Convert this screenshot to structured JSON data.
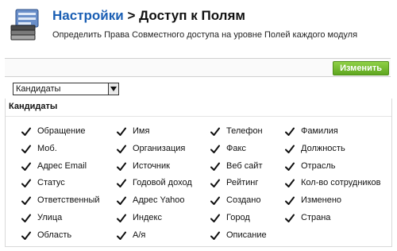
{
  "header": {
    "breadcrumb_link": "Настройки",
    "separator": ">",
    "page_title": "Доступ к Полям",
    "description": "Определить Права Совместного доступа на уровне Полей каждого модуля",
    "icon": "settings-list-icon"
  },
  "toolbar": {
    "edit_label": "Изменить",
    "edit_color": "#6bb52a"
  },
  "module_select": {
    "value": "Кандидаты"
  },
  "section": {
    "title": "Кандидаты",
    "fields": [
      {
        "label": "Обращение",
        "checked": true
      },
      {
        "label": "Имя",
        "checked": true
      },
      {
        "label": "Телефон",
        "checked": true
      },
      {
        "label": "Фамилия",
        "checked": true
      },
      {
        "label": "Моб.",
        "checked": true
      },
      {
        "label": "Организация",
        "checked": true
      },
      {
        "label": "Факс",
        "checked": true
      },
      {
        "label": "Должность",
        "checked": true
      },
      {
        "label": "Адрес Email",
        "checked": true
      },
      {
        "label": "Источник",
        "checked": true
      },
      {
        "label": "Веб сайт",
        "checked": true
      },
      {
        "label": "Отрасль",
        "checked": true
      },
      {
        "label": "Статус",
        "checked": true
      },
      {
        "label": "Годовой доход",
        "checked": true
      },
      {
        "label": "Рейтинг",
        "checked": true
      },
      {
        "label": "Кол-во сотрудников",
        "checked": true
      },
      {
        "label": "Ответственный",
        "checked": true
      },
      {
        "label": "Адрес Yahoo",
        "checked": true
      },
      {
        "label": "Создано",
        "checked": true
      },
      {
        "label": "Изменено",
        "checked": true
      },
      {
        "label": "Улица",
        "checked": true
      },
      {
        "label": "Индекс",
        "checked": true
      },
      {
        "label": "Город",
        "checked": true
      },
      {
        "label": "Страна",
        "checked": true
      },
      {
        "label": "Область",
        "checked": true
      },
      {
        "label": "А/я",
        "checked": true
      },
      {
        "label": "Описание",
        "checked": true
      }
    ]
  }
}
